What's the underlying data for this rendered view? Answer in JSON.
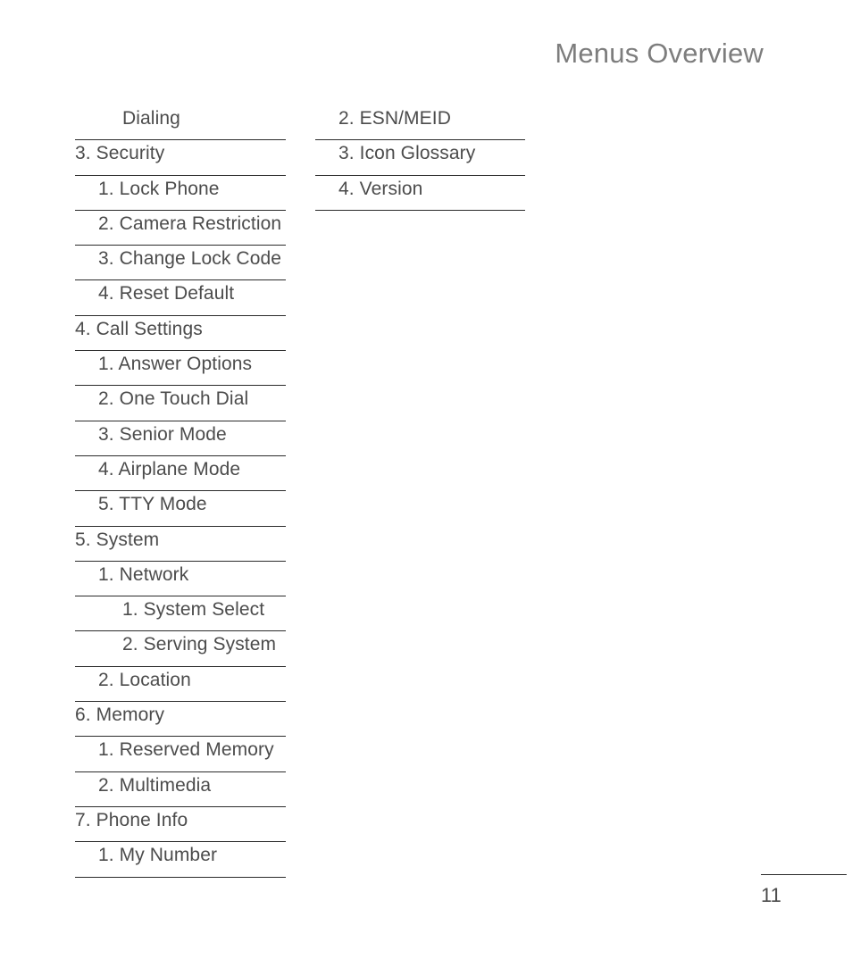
{
  "document": {
    "title": "Menus Overview",
    "page_number": "11"
  },
  "menu": {
    "left_column": [
      {
        "label": "Dialing",
        "level": 2
      },
      {
        "label": "3. Security",
        "level": 0
      },
      {
        "label": "1. Lock Phone",
        "level": 1
      },
      {
        "label": "2. Camera Restriction",
        "level": 1
      },
      {
        "label": "3. Change Lock Code",
        "level": 1
      },
      {
        "label": "4. Reset Default",
        "level": 1
      },
      {
        "label": "4. Call Settings",
        "level": 0
      },
      {
        "label": "1. Answer Options",
        "level": 1
      },
      {
        "label": "2. One Touch Dial",
        "level": 1
      },
      {
        "label": "3. Senior Mode",
        "level": 1
      },
      {
        "label": "4. Airplane Mode",
        "level": 1
      },
      {
        "label": "5. TTY Mode",
        "level": 1
      },
      {
        "label": "5. System",
        "level": 0
      },
      {
        "label": "1. Network",
        "level": 1
      },
      {
        "label": "1. System Select",
        "level": 2
      },
      {
        "label": "2. Serving System",
        "level": 2
      },
      {
        "label": "2. Location",
        "level": 1
      },
      {
        "label": "6. Memory",
        "level": 0
      },
      {
        "label": "1. Reserved Memory",
        "level": 1
      },
      {
        "label": "2. Multimedia",
        "level": 1
      },
      {
        "label": "7. Phone Info",
        "level": 0
      },
      {
        "label": "1. My Number",
        "level": 1
      }
    ],
    "right_column": [
      {
        "label": "2. ESN/MEID",
        "level": 1
      },
      {
        "label": "3. Icon Glossary",
        "level": 1
      },
      {
        "label": "4. Version",
        "level": 1
      }
    ]
  },
  "colors": {
    "title": "#7d7d7d",
    "body_text": "#4c4c4c",
    "rule": "#2b2b2b",
    "background": "#ffffff"
  }
}
